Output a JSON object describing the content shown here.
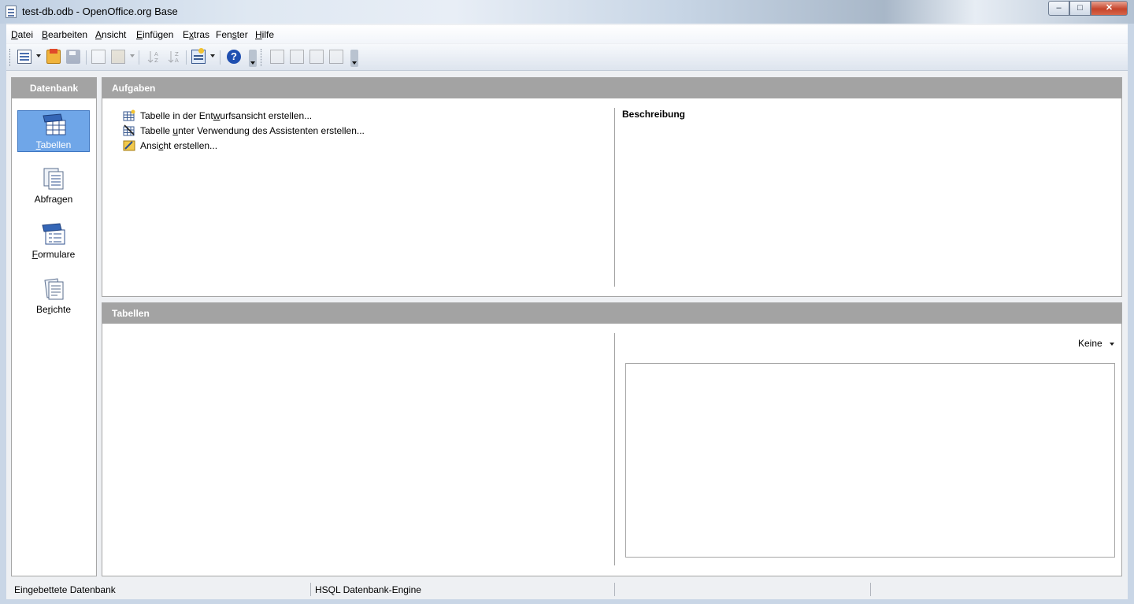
{
  "window": {
    "title": "test-db.odb - OpenOffice.org Base",
    "controls": {
      "minimize": "‒",
      "maximize": "□",
      "close": "✕"
    }
  },
  "menu": [
    {
      "pre": "",
      "u": "D",
      "post": "atei"
    },
    {
      "pre": "",
      "u": "B",
      "post": "earbeiten"
    },
    {
      "pre": "",
      "u": "A",
      "post": "nsicht"
    },
    {
      "pre": "",
      "u": "E",
      "post": "infügen"
    },
    {
      "pre": "E",
      "u": "x",
      "post": "tras"
    },
    {
      "pre": "Fen",
      "u": "s",
      "post": "ter"
    },
    {
      "pre": "",
      "u": "H",
      "post": "ilfe"
    }
  ],
  "toolbar": {
    "icons": [
      "new-document-icon",
      "open-folder-icon",
      "save-icon",
      "copy-icon",
      "paste-icon",
      "sort-ascending-icon",
      "sort-descending-icon",
      "form-icon",
      "help-icon",
      "open-database-object-icon",
      "edit-icon",
      "delete-icon",
      "rename-icon"
    ]
  },
  "database_panel": {
    "header": "Datenbank",
    "items": [
      {
        "pre": "",
        "u": "T",
        "post": "abellen",
        "icon": "tables-icon",
        "selected": true
      },
      {
        "pre": "Abfra",
        "u": "g",
        "post": "en",
        "icon": "queries-icon",
        "selected": false
      },
      {
        "pre": "",
        "u": "F",
        "post": "ormulare",
        "icon": "forms-icon",
        "selected": false
      },
      {
        "pre": "Be",
        "u": "r",
        "post": "ichte",
        "icon": "reports-icon",
        "selected": false
      }
    ]
  },
  "tasks_panel": {
    "header": "Aufgaben",
    "tasks": [
      {
        "pre": "Tabelle in der Ent",
        "u": "w",
        "post": "urfsansicht erstellen...",
        "icon": "table-design-icon"
      },
      {
        "pre": "Tabelle ",
        "u": "u",
        "post": "nter Verwendung des Assistenten erstellen...",
        "icon": "table-wizard-icon"
      },
      {
        "pre": "Ansi",
        "u": "c",
        "post": "ht erstellen...",
        "icon": "view-create-icon"
      }
    ],
    "description_title": "Beschreibung"
  },
  "tables_panel": {
    "header": "Tabellen",
    "preview_mode": "Keine"
  },
  "statusbar": {
    "fields": [
      "Eingebettete Datenbank",
      "HSQL Datenbank-Engine",
      "",
      ""
    ]
  },
  "colors": {
    "selection": "#6fa6e8",
    "panel_header": "#a3a3a3",
    "background": "#eef0f3"
  }
}
